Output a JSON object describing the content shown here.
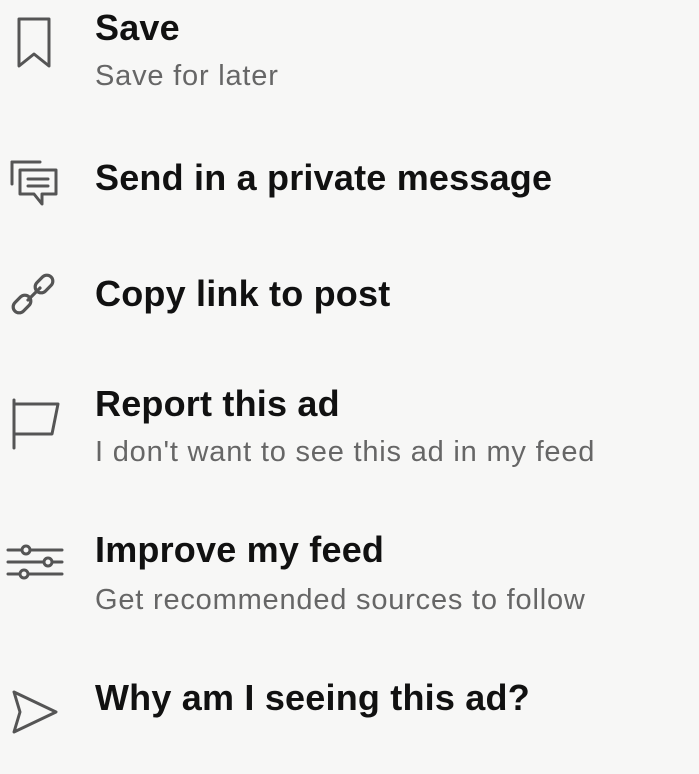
{
  "menu": {
    "items": [
      {
        "label": "Save",
        "sub": "Save for later",
        "icon": "bookmark-icon"
      },
      {
        "label": "Send in a private message",
        "sub": "",
        "icon": "message-icon"
      },
      {
        "label": "Copy link to post",
        "sub": "",
        "icon": "link-icon"
      },
      {
        "label": "Report this ad",
        "sub": "I don't want to see this ad in my feed",
        "icon": "flag-icon"
      },
      {
        "label": "Improve my feed",
        "sub": "Get recommended sources to follow",
        "icon": "sliders-icon"
      },
      {
        "label": "Why am I seeing this ad?",
        "sub": "",
        "icon": "send-icon"
      }
    ]
  }
}
